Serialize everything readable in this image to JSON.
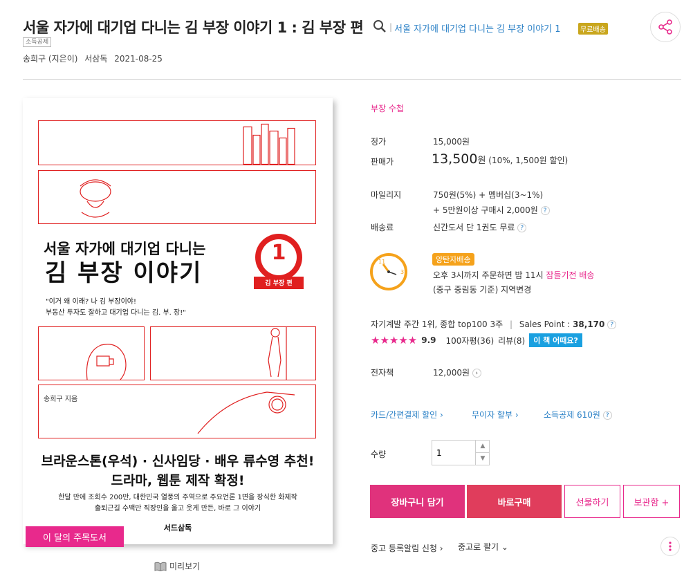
{
  "header": {
    "title": "서울 자가에 대기업 다니는 김 부장 이야기 1 : 김 부장 편",
    "series_link": "서울 자가에 대기업 다니는 김 부장 이야기 1",
    "free_badge": "무료배송",
    "tax_tag": "소득공제",
    "author": "송희구 (지은이)",
    "publisher": "서삼독",
    "pub_date": "2021-08-25"
  },
  "cover": {
    "title_line1": "서울 자가에 대기업 다니는",
    "title_line2": "김 부장 이야기",
    "seal_number": "1",
    "seal_label": "김 부장 편",
    "quote_line1": "\"이거 왜 이래? 나 김 부장이야!",
    "quote_line2": "부동산 투자도 잘하고 대기업 다니는 김. 부. 장!\"",
    "author_text": "송희구 지음",
    "promo_line1": "브라운스톤(우석) · 신사임당 · 배우 류수영 추천!",
    "promo_line2": "드라마, 웹툰 제작 확정!",
    "desc_line1": "한달 만에 조회수 200만, 대한민국 열풍의 주역으로 주요언론 1면을 장식한 화제작",
    "desc_line2": "출퇴근길 수백만 직장인을 울고 웃게 만든, 바로 그 이야기",
    "publisher_logo": "서드삼독"
  },
  "month_badge": "이 달의 주목도서",
  "preview_label": "미리보기",
  "info": {
    "category": "부장 수첩",
    "list_price_label": "정가",
    "list_price": "15,000원",
    "sale_price_label": "판매가",
    "sale_price": "13,500",
    "sale_price_unit": "원",
    "discount": "(10%, 1,500원 할인)",
    "mileage_label": "마일리지",
    "mileage_line1": "750원(5%) + 멤버십(3~1%)",
    "mileage_line2": "+ 5만원이상 구매시 2,000원",
    "shipping_label": "배송료",
    "shipping": "신간도서 단 1권도 무료",
    "delivery_badge": "양탄자배송",
    "delivery_line1_pre": "오후 3시까지 주문하면 밤 11시 ",
    "delivery_line1_link": "잠들기전 배송",
    "delivery_line2_pre": "(중구 중림동 기준) ",
    "delivery_line2_link": "지역변경",
    "clock_11": "11",
    "clock_3": "3",
    "rank_text": "자기계발 주간 1위, 종합 top100 3주",
    "sales_point_label": "Sales Point : ",
    "sales_point": "38,170",
    "rating": "9.9",
    "rating_stars": 5,
    "review_100": "100자평(36)",
    "review": "리뷰(8)",
    "how_badge": "이 책 어때요?",
    "ebook_label": "전자책",
    "ebook_price": "12,000원",
    "promo_card": "카드/간편결제 할인",
    "promo_installment": "무이자 할부",
    "promo_tax": "소득공제 610원",
    "qty_label": "수량",
    "qty_value": "1"
  },
  "buttons": {
    "cart": "장바구니 담기",
    "buy": "바로구매",
    "gift": "선물하기",
    "keep": "보관함 +"
  },
  "footer": {
    "used_alert": "중고 등록알림 신청",
    "sell_used": "중고로 팔기"
  },
  "colors": {
    "accent_pink": "#e8298c",
    "buy_red": "#e03d5c",
    "link_blue": "#2a80c6",
    "badge_orange": "#f5a21b",
    "badge_gold": "#c9a61d",
    "badge_blue": "#1aa0e0"
  }
}
